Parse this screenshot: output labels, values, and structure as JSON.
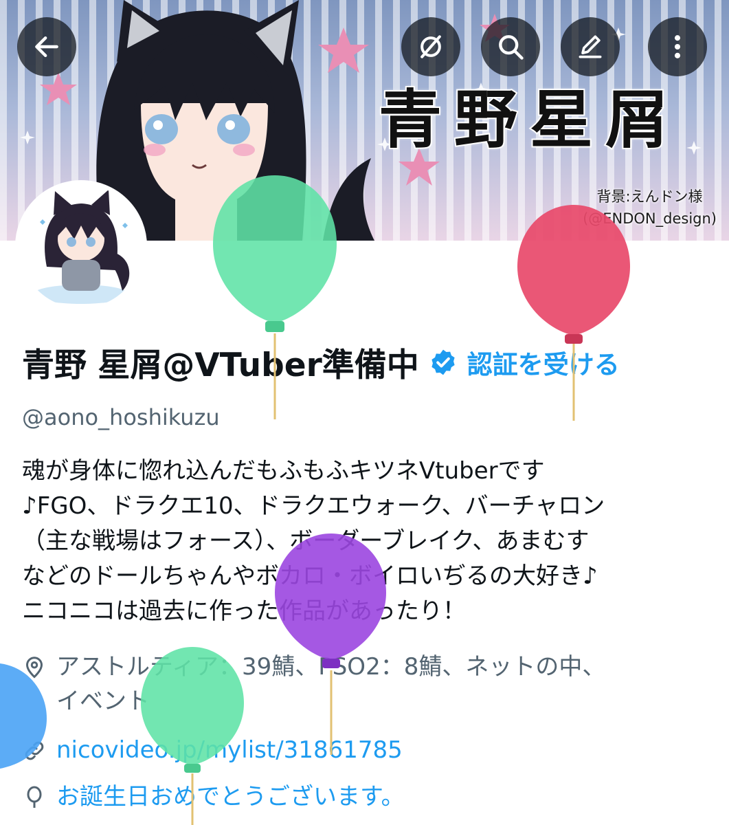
{
  "banner": {
    "title": "青野星屑",
    "credit_line1": "背景:えんドン様",
    "credit_line2": "(@ENDON_design)"
  },
  "toolbar": {
    "back": "back-arrow-icon",
    "hide": "eye-slash-icon",
    "search": "search-icon",
    "edit": "pencil-icon",
    "more": "more-vertical-icon"
  },
  "profile": {
    "display_name": "青野 星屑@VTuber準備中",
    "verify_label": "認証を受ける",
    "handle": "@aono_hoshikuzu",
    "bio_lines": [
      "魂が身体に惚れ込んだもふもふキツネVtuberです",
      "♪FGO、ドラクエ10、ドラクエウォーク、バーチャロン",
      "（主な戦場はフォース）、ボーダーブレイク、あまむす",
      "などのドールちゃんやボカロ・ボイロいぢるの大好き♪",
      "ニコニコは過去に作った作品があったり！"
    ],
    "location_line1": "アストルティア：39鯖、PSO2：8鯖、ネットの中、",
    "location_line2": "イベント",
    "link": "nicovideo.jp/mylist/31861785",
    "birthday": "お誕生日おめでとうございます。"
  },
  "colors": {
    "accent": "#1d9bf0",
    "secondary_text": "#536471",
    "balloon_green": "#5fe3a6",
    "balloon_red": "#e8496a",
    "balloon_purple": "#9b46e0",
    "balloon_blue": "#4aa3f5"
  }
}
